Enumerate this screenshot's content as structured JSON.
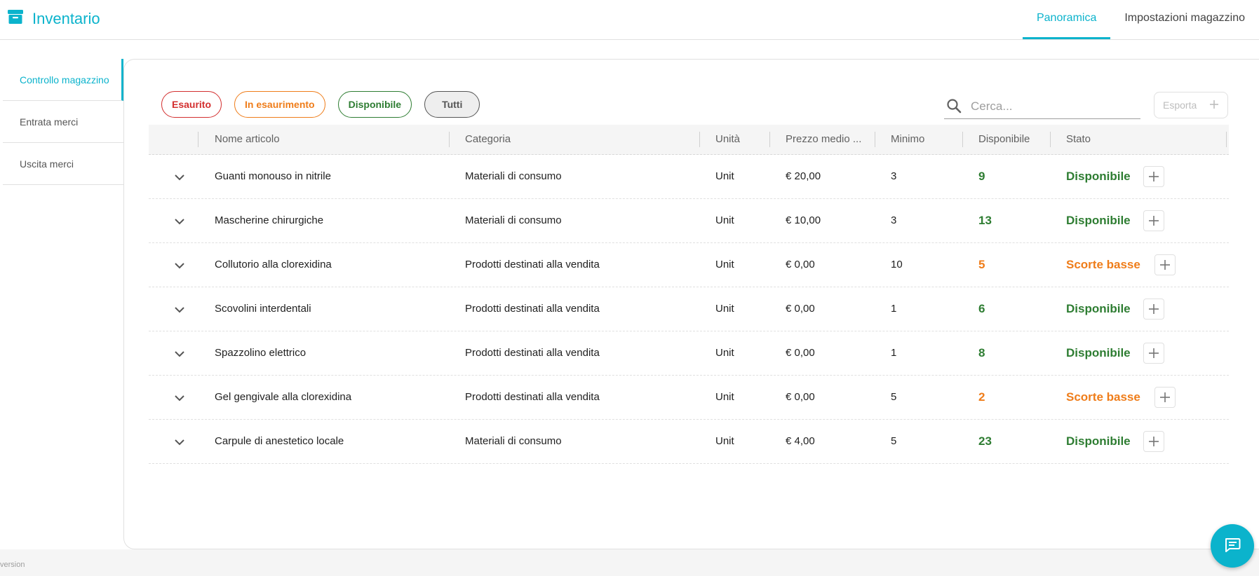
{
  "app": {
    "title": "Inventario"
  },
  "top_tabs": [
    {
      "label": "Panoramica",
      "active": true
    },
    {
      "label": "Impostazioni magazzino",
      "active": false
    }
  ],
  "sidebar": {
    "items": [
      {
        "label": "Controllo magazzino",
        "active": true
      },
      {
        "label": "Entrata merci",
        "active": false
      },
      {
        "label": "Uscita merci",
        "active": false
      }
    ]
  },
  "filters": {
    "out_of_stock": "Esaurito",
    "low": "In esaurimento",
    "available": "Disponibile",
    "all": "Tutti"
  },
  "search": {
    "placeholder": "Cerca..."
  },
  "export": {
    "label": "Esporta"
  },
  "table": {
    "headers": [
      "Nome articolo",
      "Categoria",
      "Unità",
      "Prezzo medio ...",
      "Minimo",
      "Disponibile",
      "Stato"
    ],
    "rows": [
      {
        "name": "Guanti monouso in nitrile",
        "category": "Materiali di consumo",
        "unit": "Unit",
        "price": "€ 20,00",
        "min": "3",
        "available": "9",
        "state": "Disponibile",
        "status": "ok"
      },
      {
        "name": "Mascherine chirurgiche",
        "category": "Materiali di consumo",
        "unit": "Unit",
        "price": "€ 10,00",
        "min": "3",
        "available": "13",
        "state": "Disponibile",
        "status": "ok"
      },
      {
        "name": "Collutorio alla clorexidina",
        "category": "Prodotti destinati alla vendita",
        "unit": "Unit",
        "price": "€ 0,00",
        "min": "10",
        "available": "5",
        "state": "Scorte basse",
        "status": "low"
      },
      {
        "name": "Scovolini interdentali",
        "category": "Prodotti destinati alla vendita",
        "unit": "Unit",
        "price": "€ 0,00",
        "min": "1",
        "available": "6",
        "state": "Disponibile",
        "status": "ok"
      },
      {
        "name": "Spazzolino elettrico",
        "category": "Prodotti destinati alla vendita",
        "unit": "Unit",
        "price": "€ 0,00",
        "min": "1",
        "available": "8",
        "state": "Disponibile",
        "status": "ok"
      },
      {
        "name": "Gel gengivale alla clorexidina",
        "category": "Prodotti destinati alla vendita",
        "unit": "Unit",
        "price": "€ 0,00",
        "min": "5",
        "available": "2",
        "state": "Scorte basse",
        "status": "low"
      },
      {
        "name": "Carpule di anestetico locale",
        "category": "Materiali di consumo",
        "unit": "Unit",
        "price": "€ 4,00",
        "min": "5",
        "available": "23",
        "state": "Disponibile",
        "status": "ok"
      }
    ]
  },
  "footer": {
    "version": "version"
  },
  "colors": {
    "accent": "#0bb3cc",
    "ok": "#2e7d32",
    "low": "#ef7d1a",
    "out": "#d32f2f"
  },
  "icons": {
    "brand": "archive-box-icon",
    "search": "search-icon",
    "chat": "chat-icon",
    "expand": "chevron-down-icon",
    "add": "plus-icon"
  }
}
